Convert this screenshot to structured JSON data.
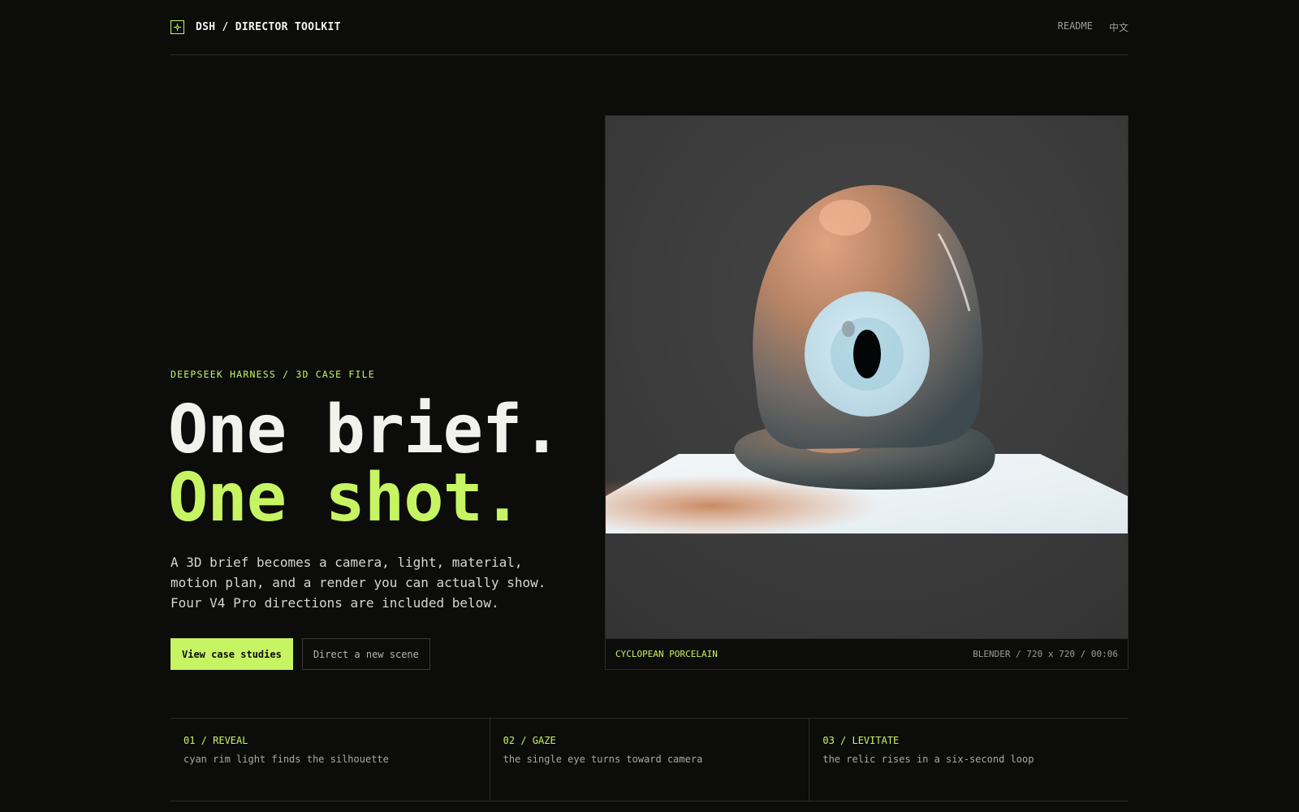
{
  "header": {
    "brand": "DSH / DIRECTOR TOOLKIT",
    "nav": [
      "README",
      "中文"
    ]
  },
  "hero": {
    "eyebrow": "DEEPSEEK HARNESS / 3D CASE FILE",
    "headline_line1": "One brief.",
    "headline_line2": "One shot.",
    "lede": "A 3D brief becomes a camera, light, material, motion plan, and a render you can actually show. Four V4 Pro directions are included below.",
    "primary_cta": "View case studies",
    "secondary_cta": "Direct a new scene"
  },
  "media": {
    "title": "CYCLOPEAN PORCELAIN",
    "meta": "BLENDER / 720 x 720 / 00:06"
  },
  "steps": [
    {
      "label": "01 / REVEAL",
      "desc": "cyan rim light finds the silhouette"
    },
    {
      "label": "02 / GAZE",
      "desc": "the single eye turns toward camera"
    },
    {
      "label": "03 / LEVITATE",
      "desc": "the relic rises in a six-second loop"
    }
  ],
  "colors": {
    "background": "#0c0c0b",
    "accent": "#c7f463",
    "text": "#f2f2ec",
    "muted": "#9a9a94",
    "border": "#2c2c2a"
  },
  "icons": {
    "brand": "crosshair-square-icon"
  }
}
